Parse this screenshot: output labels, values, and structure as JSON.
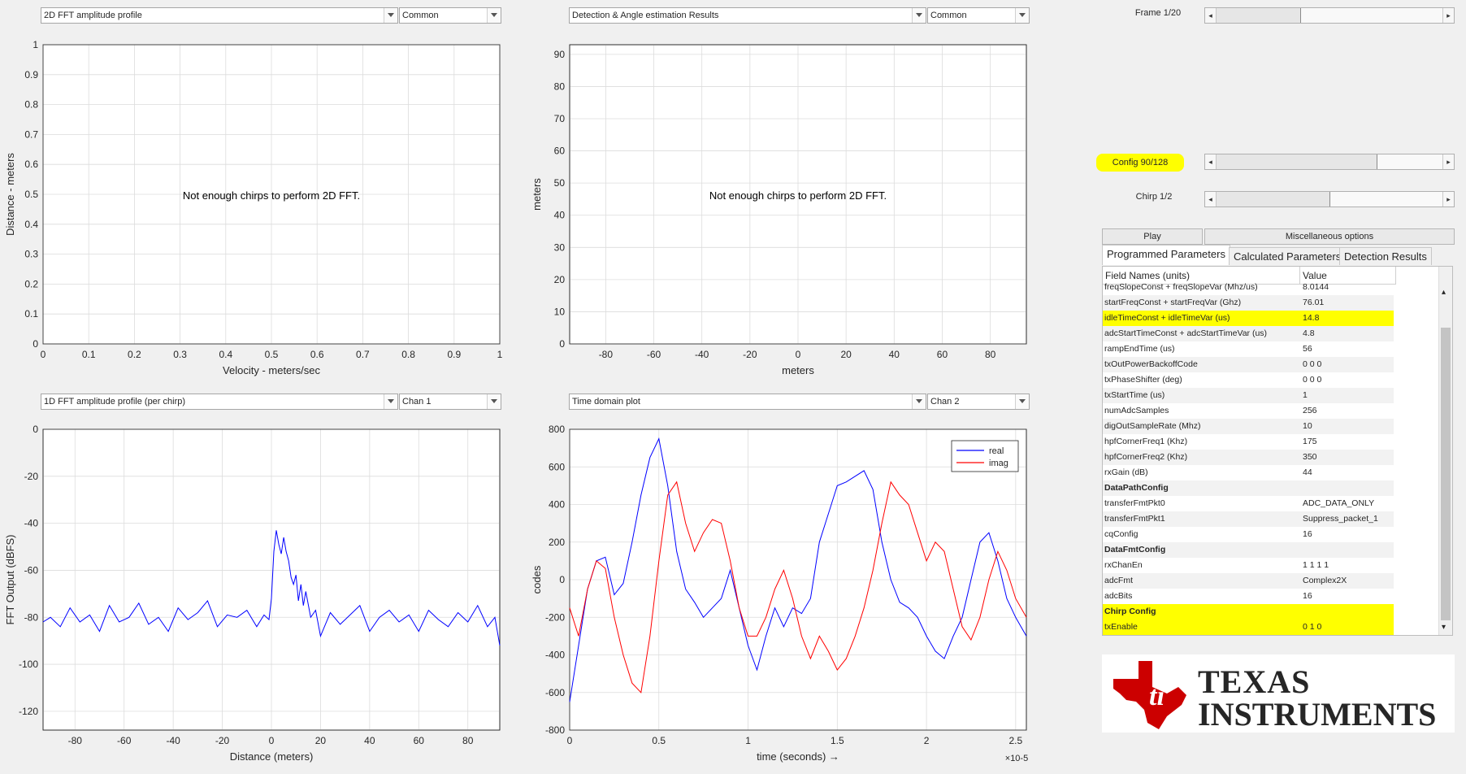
{
  "panels": {
    "top_left": {
      "dropdown1": "2D FFT amplitude profile",
      "dropdown2": "Common"
    },
    "top_right": {
      "dropdown1": "Detection & Angle estimation Results",
      "dropdown2": "Common"
    },
    "bottom_left": {
      "dropdown1": "1D FFT amplitude profile (per chirp)",
      "dropdown2": "Chan 1"
    },
    "bottom_right": {
      "dropdown1": "Time domain plot",
      "dropdown2": "Chan 2"
    }
  },
  "controls": {
    "frame_label": "Frame 1/20",
    "config_label": "Config 90/128",
    "chirp_label": "Chirp 1/2",
    "frame_fraction": 0.37,
    "config_fraction": 0.71,
    "chirp_fraction": 0.5,
    "play_label": "Play",
    "misc_label": "Miscellaneous options",
    "left_arrow": "◂",
    "right_arrow": "▸"
  },
  "tabs": [
    "Programmed Parameters",
    "Calculated Parameters",
    "Detection Results"
  ],
  "table": {
    "col_field": "Field Names    (units)",
    "col_value": "Value",
    "rows": [
      {
        "f": "freqSlopeConst + freqSlopeVar (Mhz/us)",
        "v": "8.0144"
      },
      {
        "f": "startFreqConst + startFreqVar (Ghz)",
        "v": "76.01"
      },
      {
        "f": "idleTimeConst + idleTimeVar (us)",
        "v": "14.8",
        "hl": true
      },
      {
        "f": "adcStartTimeConst + adcStartTimeVar (us)",
        "v": "4.8"
      },
      {
        "f": "rampEndTime (us)",
        "v": "56"
      },
      {
        "f": "txOutPowerBackoffCode",
        "v": "0 0 0"
      },
      {
        "f": "txPhaseShifter (deg)",
        "v": "0 0 0"
      },
      {
        "f": "txStartTime (us)",
        "v": "1"
      },
      {
        "f": "numAdcSamples",
        "v": "256"
      },
      {
        "f": "digOutSampleRate (Mhz)",
        "v": "10"
      },
      {
        "f": "hpfCornerFreq1 (Khz)",
        "v": "175"
      },
      {
        "f": "hpfCornerFreq2 (Khz)",
        "v": "350"
      },
      {
        "f": "rxGain (dB)",
        "v": "44"
      },
      {
        "f": "DataPathConfig",
        "v": "",
        "bold": true
      },
      {
        "f": "transferFmtPkt0",
        "v": "ADC_DATA_ONLY"
      },
      {
        "f": "transferFmtPkt1",
        "v": "Suppress_packet_1"
      },
      {
        "f": "cqConfig",
        "v": "16"
      },
      {
        "f": "DataFmtConfig",
        "v": "",
        "bold": true
      },
      {
        "f": "rxChanEn",
        "v": "1 1 1 1"
      },
      {
        "f": "adcFmt",
        "v": "Complex2X"
      },
      {
        "f": "adcBits",
        "v": "16"
      },
      {
        "f": "Chirp Config",
        "v": "",
        "bold": true,
        "hl": true
      },
      {
        "f": "txEnable",
        "v": "0 1 0",
        "hl": true
      }
    ]
  },
  "logo": {
    "line1": "TEXAS",
    "line2": "INSTRUMENTS"
  },
  "chart_data": [
    {
      "type": "scatter",
      "title": "",
      "xlabel": "Velocity - meters/sec",
      "ylabel": "Distance - meters",
      "xlim": [
        0,
        1
      ],
      "ylim": [
        0,
        1
      ],
      "xticks": [
        "0",
        "0.1",
        "0.2",
        "0.3",
        "0.4",
        "0.5",
        "0.6",
        "0.7",
        "0.8",
        "0.9",
        "1"
      ],
      "yticks": [
        "0",
        "0.1",
        "0.2",
        "0.3",
        "0.4",
        "0.5",
        "0.6",
        "0.7",
        "0.8",
        "0.9",
        "1"
      ],
      "annotation": "Not enough chirps to perform 2D FFT.",
      "grid": true,
      "values": []
    },
    {
      "type": "scatter",
      "title": "",
      "xlabel": "meters",
      "ylabel": "meters",
      "xlim": [
        -95,
        95
      ],
      "ylim": [
        0,
        93
      ],
      "xticks": [
        "-80",
        "-60",
        "-40",
        "-20",
        "0",
        "20",
        "40",
        "60",
        "80"
      ],
      "yticks": [
        "0",
        "10",
        "20",
        "30",
        "40",
        "50",
        "60",
        "70",
        "80",
        "90"
      ],
      "annotation": "Not enough chirps to perform 2D FFT.",
      "grid": true,
      "values": []
    },
    {
      "type": "line",
      "title": "",
      "xlabel": "Distance (meters)",
      "ylabel": "FFT Output (dBFS)",
      "xlim": [
        -93,
        93
      ],
      "ylim": [
        -128,
        0
      ],
      "xticks": [
        "-80",
        "-60",
        "-40",
        "-20",
        "0",
        "20",
        "40",
        "60",
        "80"
      ],
      "yticks": [
        "0",
        "-20",
        "-40",
        "-60",
        "-80",
        "-100",
        "-120"
      ],
      "grid": true,
      "series": [
        {
          "color": "#0000ff",
          "x": [
            -93,
            -90,
            -86,
            -82,
            -78,
            -74,
            -70,
            -66,
            -62,
            -58,
            -54,
            -50,
            -46,
            -42,
            -38,
            -34,
            -30,
            -26,
            -22,
            -18,
            -14,
            -10,
            -6,
            -3,
            -1,
            0,
            1,
            2,
            3,
            4,
            5,
            6,
            7,
            8,
            9,
            10,
            11,
            12,
            13,
            14,
            16,
            18,
            20,
            24,
            28,
            32,
            36,
            40,
            44,
            48,
            52,
            56,
            60,
            64,
            68,
            72,
            76,
            80,
            84,
            88,
            91,
            93
          ],
          "y": [
            -82,
            -80,
            -84,
            -76,
            -82,
            -79,
            -86,
            -75,
            -82,
            -80,
            -74,
            -83,
            -80,
            -86,
            -76,
            -81,
            -78,
            -73,
            -84,
            -79,
            -80,
            -77,
            -84,
            -79,
            -81,
            -72,
            -52,
            -43,
            -49,
            -53,
            -46,
            -52,
            -56,
            -63,
            -66,
            -62,
            -73,
            -66,
            -75,
            -69,
            -80,
            -77,
            -88,
            -78,
            -83,
            -79,
            -75,
            -86,
            -80,
            -77,
            -82,
            -79,
            -86,
            -77,
            -81,
            -84,
            -78,
            -82,
            -75,
            -84,
            -80,
            -92
          ]
        }
      ]
    },
    {
      "type": "line",
      "title": "",
      "xlabel": "time  (seconds) →",
      "ylabel": "codes",
      "xlim": [
        0,
        2.56
      ],
      "ylim": [
        -800,
        800
      ],
      "x_multiplier": "×10-5",
      "xticks": [
        "0",
        "0.5",
        "1",
        "1.5",
        "2",
        "2.5"
      ],
      "yticks": [
        "800",
        "600",
        "400",
        "200",
        "0",
        "-200",
        "-400",
        "-600",
        "-800"
      ],
      "legend": "top-right",
      "grid": true,
      "series": [
        {
          "name": "real",
          "color": "#0000ff",
          "x": [
            0,
            0.05,
            0.1,
            0.15,
            0.2,
            0.25,
            0.3,
            0.35,
            0.4,
            0.45,
            0.5,
            0.55,
            0.6,
            0.65,
            0.7,
            0.75,
            0.8,
            0.85,
            0.9,
            0.95,
            1.0,
            1.05,
            1.1,
            1.15,
            1.2,
            1.25,
            1.3,
            1.35,
            1.4,
            1.45,
            1.5,
            1.55,
            1.6,
            1.65,
            1.7,
            1.75,
            1.8,
            1.85,
            1.9,
            1.95,
            2.0,
            2.05,
            2.1,
            2.15,
            2.2,
            2.25,
            2.3,
            2.35,
            2.4,
            2.45,
            2.5,
            2.56
          ],
          "y": [
            -650,
            -350,
            -50,
            100,
            120,
            -80,
            -20,
            200,
            450,
            650,
            750,
            500,
            150,
            -50,
            -120,
            -200,
            -150,
            -100,
            50,
            -150,
            -350,
            -480,
            -300,
            -150,
            -250,
            -150,
            -180,
            -100,
            200,
            350,
            500,
            520,
            550,
            580,
            480,
            200,
            0,
            -120,
            -150,
            -200,
            -300,
            -380,
            -420,
            -300,
            -200,
            0,
            200,
            250,
            100,
            -100,
            -200,
            -300
          ]
        },
        {
          "name": "imag",
          "color": "#ff0000",
          "x": [
            0,
            0.05,
            0.1,
            0.15,
            0.2,
            0.25,
            0.3,
            0.35,
            0.4,
            0.45,
            0.5,
            0.55,
            0.6,
            0.65,
            0.7,
            0.75,
            0.8,
            0.85,
            0.9,
            0.95,
            1.0,
            1.05,
            1.1,
            1.15,
            1.2,
            1.25,
            1.3,
            1.35,
            1.4,
            1.45,
            1.5,
            1.55,
            1.6,
            1.65,
            1.7,
            1.75,
            1.8,
            1.85,
            1.9,
            1.95,
            2.0,
            2.05,
            2.1,
            2.15,
            2.2,
            2.25,
            2.3,
            2.35,
            2.4,
            2.45,
            2.5,
            2.56
          ],
          "y": [
            -150,
            -300,
            -50,
            100,
            60,
            -200,
            -400,
            -550,
            -600,
            -300,
            100,
            450,
            520,
            300,
            150,
            250,
            320,
            300,
            100,
            -150,
            -300,
            -300,
            -200,
            -50,
            50,
            -100,
            -300,
            -420,
            -300,
            -380,
            -480,
            -420,
            -300,
            -150,
            50,
            300,
            520,
            450,
            400,
            250,
            100,
            200,
            150,
            -50,
            -250,
            -320,
            -200,
            0,
            150,
            50,
            -100,
            -200
          ]
        }
      ]
    }
  ]
}
